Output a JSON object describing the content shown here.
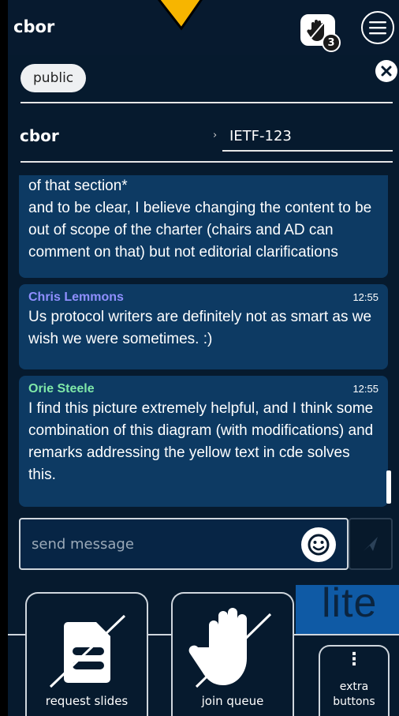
{
  "header": {
    "title": "cbor",
    "queue_count": "3"
  },
  "tags": {
    "public": "public"
  },
  "room": {
    "name": "cbor",
    "chevron": "›",
    "session": "IETF-123"
  },
  "messages": [
    {
      "author": "",
      "time": "",
      "text": "of that section*\nand to be clear, I believe changing the content to be out of scope of the charter (chairs and AD can comment on that) but not editorial clarifications"
    },
    {
      "author": "Chris Lemmons",
      "author_color": "#8f8fff",
      "time": "12:55",
      "text": "Us protocol writers are definitely not as smart as we wish we were sometimes. :)"
    },
    {
      "author": "Orie Steele",
      "author_color": "#7fe8a8",
      "time": "12:55",
      "text": "I find this picture extremely helpful, and I think some combination of this diagram (with modifications) and remarks addressing the yellow text in cde solves this."
    }
  ],
  "composer": {
    "placeholder": "send message"
  },
  "branding": {
    "lite": "lite"
  },
  "bottom": {
    "request_slides": "request slides",
    "join_queue": "join queue",
    "extra_dots": "⋮",
    "extra_label": "extra\nbuttons"
  },
  "icons": {
    "hand": "hand-icon",
    "menu": "menu-icon",
    "close": "close-icon",
    "emoji": "smiley-icon",
    "send": "send-icon",
    "slides": "slides-icon",
    "queue": "hand-icon",
    "extra": "vertical-dots-icon"
  },
  "colors": {
    "background": "#061a2e",
    "bubble": "#0d3a63",
    "accent": "#0f5aa5",
    "pointer": "#f7b500"
  }
}
